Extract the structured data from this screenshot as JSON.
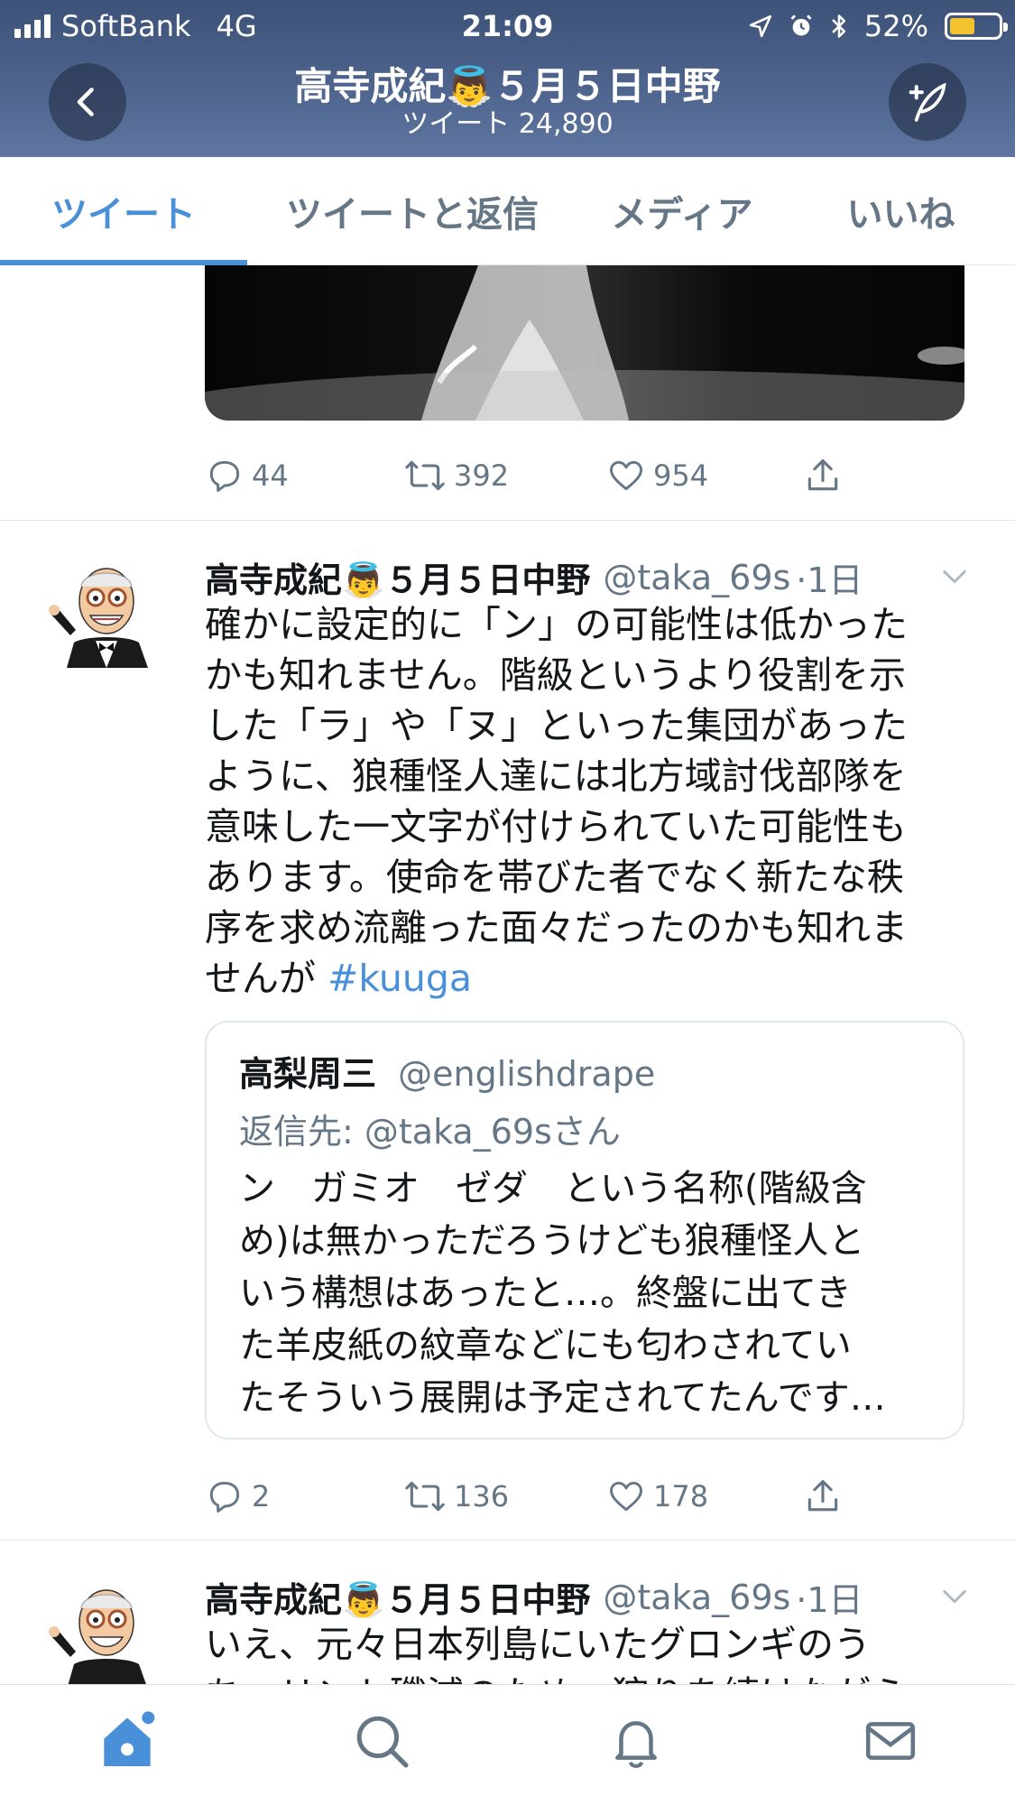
{
  "status_bar": {
    "carrier": "SoftBank",
    "network": "4G",
    "time": "21:09",
    "battery_percent": "52%",
    "battery_level": 0.52
  },
  "header": {
    "title": "高寺成紀👼５月５日中野",
    "subtitle": "ツイート 24,890"
  },
  "tabs": [
    {
      "label": "ツイート",
      "active": true
    },
    {
      "label": "ツイートと返信",
      "active": false
    },
    {
      "label": "メディア",
      "active": false
    },
    {
      "label": "いいね",
      "active": false
    }
  ],
  "first_tweet_actions": {
    "replies": "44",
    "retweets": "392",
    "likes": "954"
  },
  "tweet1": {
    "name": "高寺成紀👼５月５日中野",
    "handle": "@taka_69s",
    "time": "·1日",
    "body_lines": [
      "確かに設定的に「ン」の可能性は低かった",
      "かも知れません。階級というより役割を示",
      "した「ラ」や「ヌ」といった集団があった",
      "ように、狼種怪人達には北方域討伐部隊を",
      "意味した一文字が付けられていた可能性も",
      "あります。使命を帯びた者でなく新たな秩",
      "序を求め流離った面々だったのかも知れま"
    ],
    "body_last": "せんが ",
    "hashtag": "#kuuga",
    "quote": {
      "name": "高梨周三",
      "handle": "@englishdrape",
      "reply_to": "返信先: @taka_69sさん",
      "lines": [
        "ン　ガミオ　ゼダ　という名称(階級含",
        "め)は無かっただろうけども狼種怪人と",
        "いう構想はあったと…。終盤に出てき",
        "た羊皮紙の紋章などにも匂わされてい",
        "たそういう展開は予定されてたんです…"
      ]
    },
    "actions": {
      "replies": "2",
      "retweets": "136",
      "likes": "178"
    }
  },
  "tweet2": {
    "name": "高寺成紀👼５月５日中野",
    "handle": "@taka_69s",
    "time": "·1日",
    "body_lines": [
      "いえ、元々日本列島にいたグロンギのう",
      "ち、リント殲滅のため、狩りを続けながら"
    ]
  },
  "colors": {
    "accent": "#4a90d9",
    "header_bg": "#4a6089",
    "secondary_text": "#657786",
    "divider": "#e1e8ed"
  },
  "icons": {
    "back": "chevron-left-icon",
    "compose": "compose-feather-icon",
    "reply": "reply-bubble-icon",
    "retweet": "retweet-icon",
    "like": "heart-icon",
    "share": "share-icon",
    "home": "home-icon",
    "search": "search-icon",
    "notifications": "bell-icon",
    "messages": "mail-icon"
  }
}
